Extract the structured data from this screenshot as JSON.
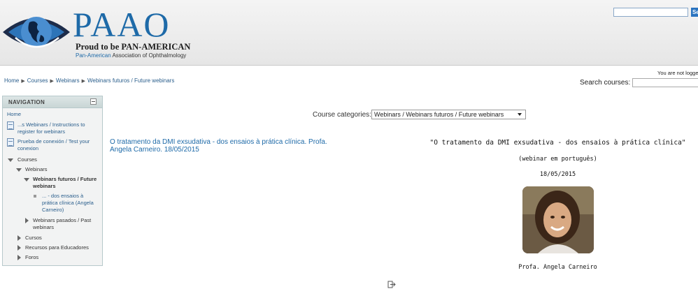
{
  "header": {
    "logo_big": "PAAO",
    "logo_tagline": "Proud to be PAN-AMERICAN",
    "logo_sub_blue": "Pan-American",
    "logo_sub_rest": "Association of Ophthalmology",
    "search_button_label": "Se"
  },
  "breadcrumb": [
    "Home",
    "Courses",
    "Webinars",
    "Webinars futuros / Future webinars"
  ],
  "login_info": "You are not logge",
  "course_search": {
    "label": "Search courses:"
  },
  "navigation": {
    "title": "NAVIGATION",
    "home": "Home",
    "items": [
      {
        "label_line1": "...s Webinars / Instructions to",
        "label_line2": "register for webinars"
      },
      {
        "label_line1": "Prueba de conexión / Test your",
        "label_line2": "conexion"
      }
    ],
    "courses": "Courses",
    "webinars": "Webinars",
    "future_line1": "Webinars futuros / Future",
    "future_line2": "webinars",
    "course_line1": "... - dos ensaios à",
    "course_line2": "prática clínica (Angela",
    "course_line3": "Carneiro)",
    "past_line1": "Webinars pasados / Past",
    "past_line2": "webinars",
    "cursos": "Cursos",
    "recursos": "Recursos para Educadores",
    "foros": "Foros"
  },
  "categories": {
    "label": "Course categories:",
    "selected": "Webinars / Webinars futuros / Future webinars"
  },
  "course": {
    "link_line1": "O tratamento da DMI exsudativa - dos ensaios à prática clínica. Profa.",
    "link_line2": "Angela Carneiro. 18/05/2015",
    "summary_title": "\"O tratamento da DMI exsudativa - dos ensaios à prática clínica\"",
    "summary_note": "(webinar em português)",
    "summary_date": "18/05/2015",
    "presenter": "Profa. Angela Carneiro"
  },
  "colors": {
    "brand_blue": "#1e6aa8",
    "nav_header": "#c9d6d6"
  }
}
